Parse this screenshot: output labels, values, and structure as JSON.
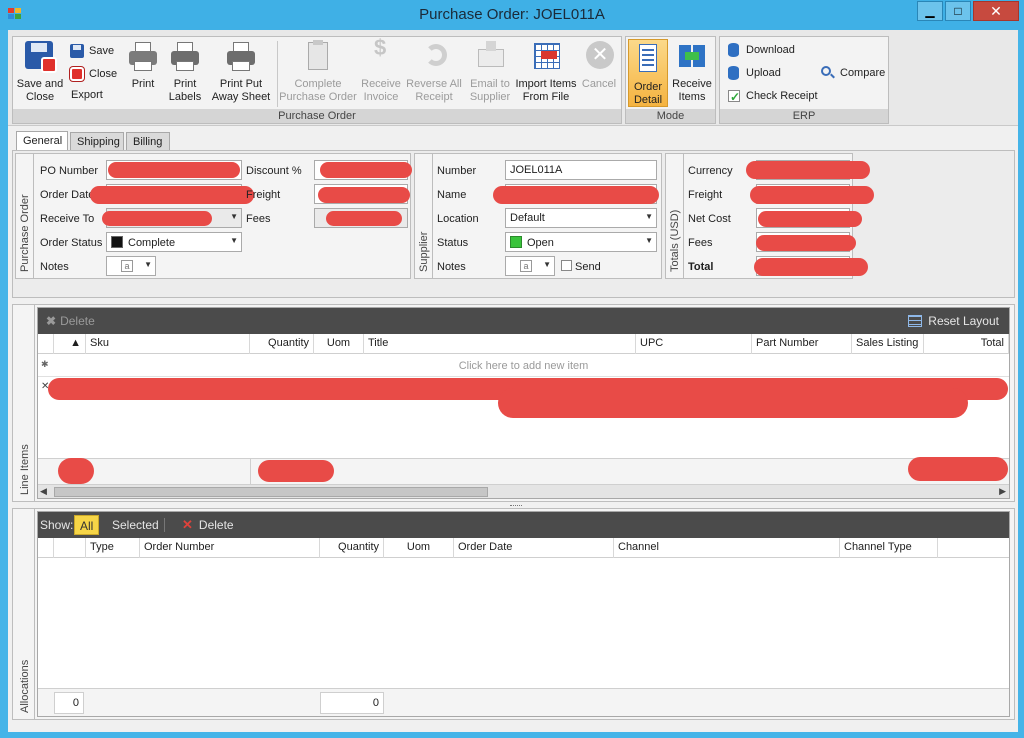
{
  "window": {
    "title": "Purchase Order: JOEL011A",
    "minimize": "▁",
    "maximize": "□",
    "close": "✕"
  },
  "ribbon": {
    "groups": {
      "purchase_order": "Purchase Order",
      "mode": "Mode",
      "erp": "ERP"
    },
    "save_and_close": "Save and\nClose",
    "save": "Save",
    "close": "Close",
    "export": "Export",
    "print": "Print",
    "print_labels": "Print\nLabels",
    "print_put_away": "Print Put\nAway Sheet",
    "complete_po": "Complete\nPurchase Order",
    "receive_invoice": "Receive\nInvoice",
    "reverse_all_receipt": "Reverse All\nReceipt",
    "email_to_supplier": "Email to\nSupplier",
    "import_items": "Import Items\nFrom File",
    "cancel": "Cancel",
    "order_detail": "Order\nDetail",
    "receive_items": "Receive\nItems",
    "download": "Download",
    "upload": "Upload",
    "check_receipt": "Check Receipt",
    "compare": "Compare"
  },
  "tabs": [
    "General",
    "Shipping",
    "Billing"
  ],
  "po_section": {
    "label": "Purchase Order",
    "po_number_label": "PO Number",
    "order_date_label": "Order Date",
    "receive_to_label": "Receive To",
    "order_status_label": "Order Status",
    "order_status_value": "Complete",
    "notes_label": "Notes",
    "notes_icon": "a",
    "discount_label": "Discount %",
    "freight_label": "Freight",
    "fees_label": "Fees"
  },
  "supplier_section": {
    "label": "Supplier",
    "number_label": "Number",
    "number_value": "JOEL011A",
    "name_label": "Name",
    "location_label": "Location",
    "location_value": "Default",
    "status_label": "Status",
    "status_value": "Open",
    "notes_label": "Notes",
    "notes_icon": "a",
    "send_label": "Send"
  },
  "totals_section": {
    "label": "Totals (USD)",
    "currency_label": "Currency",
    "freight_label": "Freight",
    "net_cost_label": "Net Cost",
    "fees_label": "Fees",
    "total_label": "Total"
  },
  "line_items": {
    "label": "Line Items",
    "delete": "Delete",
    "reset_layout": "Reset Layout",
    "columns": [
      "Sku",
      "Quantity",
      "Uom",
      "Title",
      "UPC",
      "Part Number",
      "Sales Listing",
      "Total"
    ],
    "new_item_prompt": "Click here to add new item",
    "new_row_marker": "✱",
    "row_marker": "✕",
    "sort_marker": "▲"
  },
  "allocations": {
    "label": "Allocations",
    "show_label": "Show:",
    "filter_all": "All",
    "filter_selected": "Selected",
    "delete": "Delete",
    "columns": [
      "Type",
      "Order Number",
      "Quantity",
      "Uom",
      "Order Date",
      "Channel",
      "Channel Type"
    ],
    "footer_count": "0",
    "footer_quantity": "0"
  },
  "colors": {
    "accent": "#45b4e8",
    "redaction": "#e84b47",
    "mode_active": "#f5b340"
  }
}
